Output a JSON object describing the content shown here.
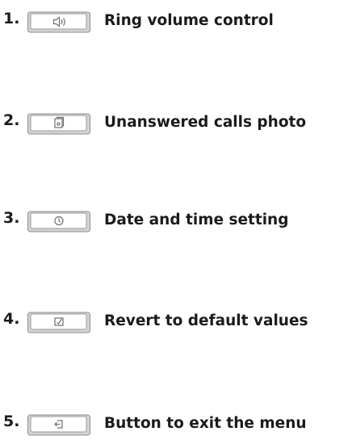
{
  "items": [
    {
      "number": "1.",
      "label": "Ring volume control",
      "icon": "speaker-icon"
    },
    {
      "number": "2.",
      "label": "Unanswered calls photo",
      "icon": "photo-icon"
    },
    {
      "number": "3.",
      "label": "Date and time setting",
      "icon": "clock-icon"
    },
    {
      "number": "4.",
      "label": "Revert to default values",
      "icon": "reset-icon"
    },
    {
      "number": "5.",
      "label": "Button to exit the menu",
      "icon": "exit-icon"
    }
  ],
  "colors": {
    "text": "#1b1b1b",
    "button_face": "#ffffff",
    "button_outline": "#8e8e8e",
    "button_shade": "#d4d4d4",
    "icon_stroke": "#6f6f6f"
  }
}
